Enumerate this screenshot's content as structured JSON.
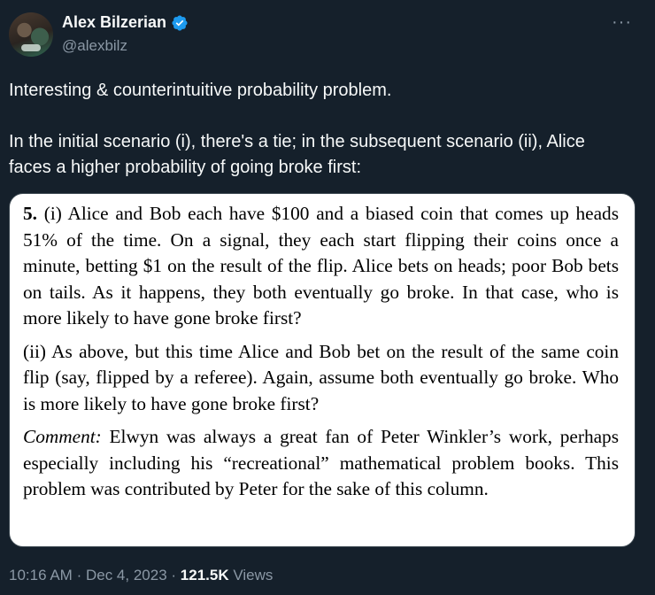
{
  "author": {
    "name": "Alex Bilzerian",
    "handle": "@alexbilz",
    "verified": true,
    "badge_color": "#1d9bf0"
  },
  "more_icon": "more-horizontal-icon",
  "tweet": {
    "line1": "Interesting & counterintuitive probability problem.",
    "line2": "In the initial scenario (i), there's a tie; in the subsequent scenario (ii), Alice faces a higher probability of going broke first:"
  },
  "media": {
    "problem_number": "5.",
    "part_i": " (i) Alice and Bob each have $100 and a biased coin that comes up heads 51% of the time. On a signal, they each start flipping their coins once a minute, betting $1 on the result of the flip. Alice bets on heads; poor Bob bets on tails. As it happens, they both eventually go broke. In that case, who is more likely to have gone broke first?",
    "part_ii": "(ii) As above, but this time Alice and Bob bet on the result of the same coin flip (say, flipped by a referee).  Again, assume both eventually go broke. Who is more likely to have gone broke first?",
    "comment_label": "Comment:",
    "comment_text": " Elwyn was always a great fan of Peter Winkler’s work, perhaps especially including his “recreational” mathematical problem books. This problem was contributed by Peter for the sake of this column."
  },
  "meta": {
    "time": "10:16 AM",
    "date": "Dec 4, 2023",
    "views_count": "121.5K",
    "views_label": "Views",
    "separator": "·"
  }
}
